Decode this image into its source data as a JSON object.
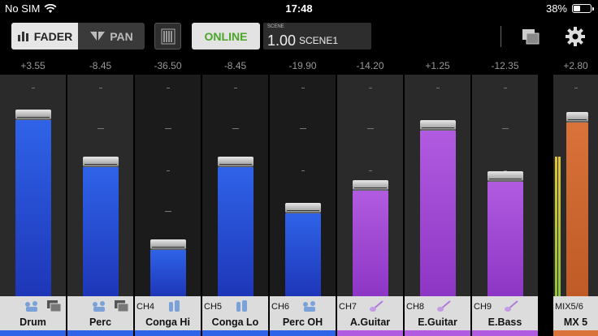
{
  "status": {
    "carrier": "No SIM",
    "time": "17:48",
    "battery_label": "38%",
    "battery_level": 0.38
  },
  "toolbar": {
    "fader_label": "FADER",
    "pan_label": "PAN",
    "online_label": "ONLINE",
    "scene_caption": "SCENE",
    "scene_number": "1.00",
    "scene_name": "SCENE1"
  },
  "colors": {
    "blue": "#2f63e8",
    "purple": "#b05be0",
    "orange": "#d9733a",
    "online": "#4aa52a"
  },
  "channels": [
    {
      "gain": "+3.55",
      "channel": "",
      "name": "Drum",
      "color": "blue",
      "level": 0.83,
      "icon": "drum-kit-icon",
      "linked": true
    },
    {
      "gain": "-8.45",
      "channel": "",
      "name": "Perc",
      "color": "blue",
      "level": 0.61,
      "icon": "percussion-icon",
      "linked": true
    },
    {
      "gain": "-36.50",
      "channel": "CH4",
      "name": "Conga Hi",
      "color": "blue",
      "level": 0.22,
      "icon": "conga-icon",
      "linked": false
    },
    {
      "gain": "-8.45",
      "channel": "CH5",
      "name": "Conga Lo",
      "color": "blue",
      "level": 0.61,
      "icon": "conga-icon",
      "linked": false
    },
    {
      "gain": "-19.90",
      "channel": "CH6",
      "name": "Perc OH",
      "color": "blue",
      "level": 0.39,
      "icon": "percussion-icon",
      "linked": false
    },
    {
      "gain": "-14.20",
      "channel": "CH7",
      "name": "A.Guitar",
      "color": "purple",
      "level": 0.5,
      "icon": "acoustic-guitar-icon",
      "linked": false
    },
    {
      "gain": "+1.25",
      "channel": "CH8",
      "name": "E.Guitar",
      "color": "purple",
      "level": 0.78,
      "icon": "electric-guitar-icon",
      "linked": false
    },
    {
      "gain": "-12.35",
      "channel": "CH9",
      "name": "E.Bass",
      "color": "purple",
      "level": 0.54,
      "icon": "bass-guitar-icon",
      "linked": false
    }
  ],
  "mix": {
    "gain": "+2.80",
    "channel": "MIX5/6",
    "name": "MX 5",
    "color": "orange",
    "level": 0.82,
    "meter_level": 0.66
  }
}
